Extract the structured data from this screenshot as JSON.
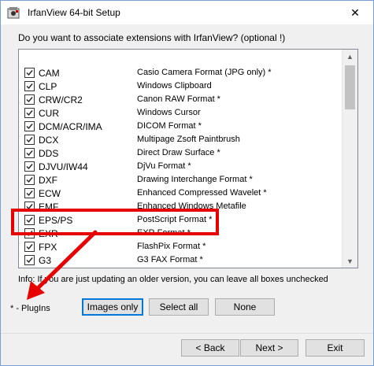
{
  "window": {
    "title": "IrfanView 64-bit Setup",
    "close_glyph": "✕",
    "icon": "irfanview-app-icon"
  },
  "question": "Do you want to associate extensions with IrfanView? (optional !)",
  "rows": [
    {
      "ext": "CAM",
      "desc": "Casio Camera Format (JPG only) *",
      "checked": true
    },
    {
      "ext": "CLP",
      "desc": "Windows Clipboard",
      "checked": true
    },
    {
      "ext": "CRW/CR2",
      "desc": "Canon RAW Format *",
      "checked": true
    },
    {
      "ext": "CUR",
      "desc": "Windows Cursor",
      "checked": true
    },
    {
      "ext": "DCM/ACR/IMA",
      "desc": "DICOM Format *",
      "checked": true
    },
    {
      "ext": "DCX",
      "desc": "Multipage Zsoft Paintbrush",
      "checked": true
    },
    {
      "ext": "DDS",
      "desc": "Direct Draw Surface *",
      "checked": true
    },
    {
      "ext": "DJVU/IW44",
      "desc": "DjVu Format *",
      "checked": true
    },
    {
      "ext": "DXF",
      "desc": "Drawing Interchange Format *",
      "checked": true
    },
    {
      "ext": "ECW",
      "desc": "Enhanced Compressed Wavelet *",
      "checked": true
    },
    {
      "ext": "EMF",
      "desc": "Enhanced Windows Metafile",
      "checked": true
    },
    {
      "ext": "EPS/PS",
      "desc": "PostScript Format *",
      "checked": true
    },
    {
      "ext": "EXR",
      "desc": "EXR Format *",
      "checked": true
    },
    {
      "ext": "FPX",
      "desc": "FlashPix Format *",
      "checked": true
    },
    {
      "ext": "G3",
      "desc": "G3 FAX Format *",
      "checked": true
    }
  ],
  "info": "Info: If you are just updating an older version, you can leave all boxes unchecked",
  "plugins_label": "* - PlugIns",
  "buttons": {
    "images_only": "Images only",
    "select_all": "Select all",
    "none": "None",
    "back": "< Back",
    "next": "Next >",
    "exit": "Exit"
  },
  "colors": {
    "highlight": "#e60000",
    "default_button_border": "#0078d7"
  }
}
